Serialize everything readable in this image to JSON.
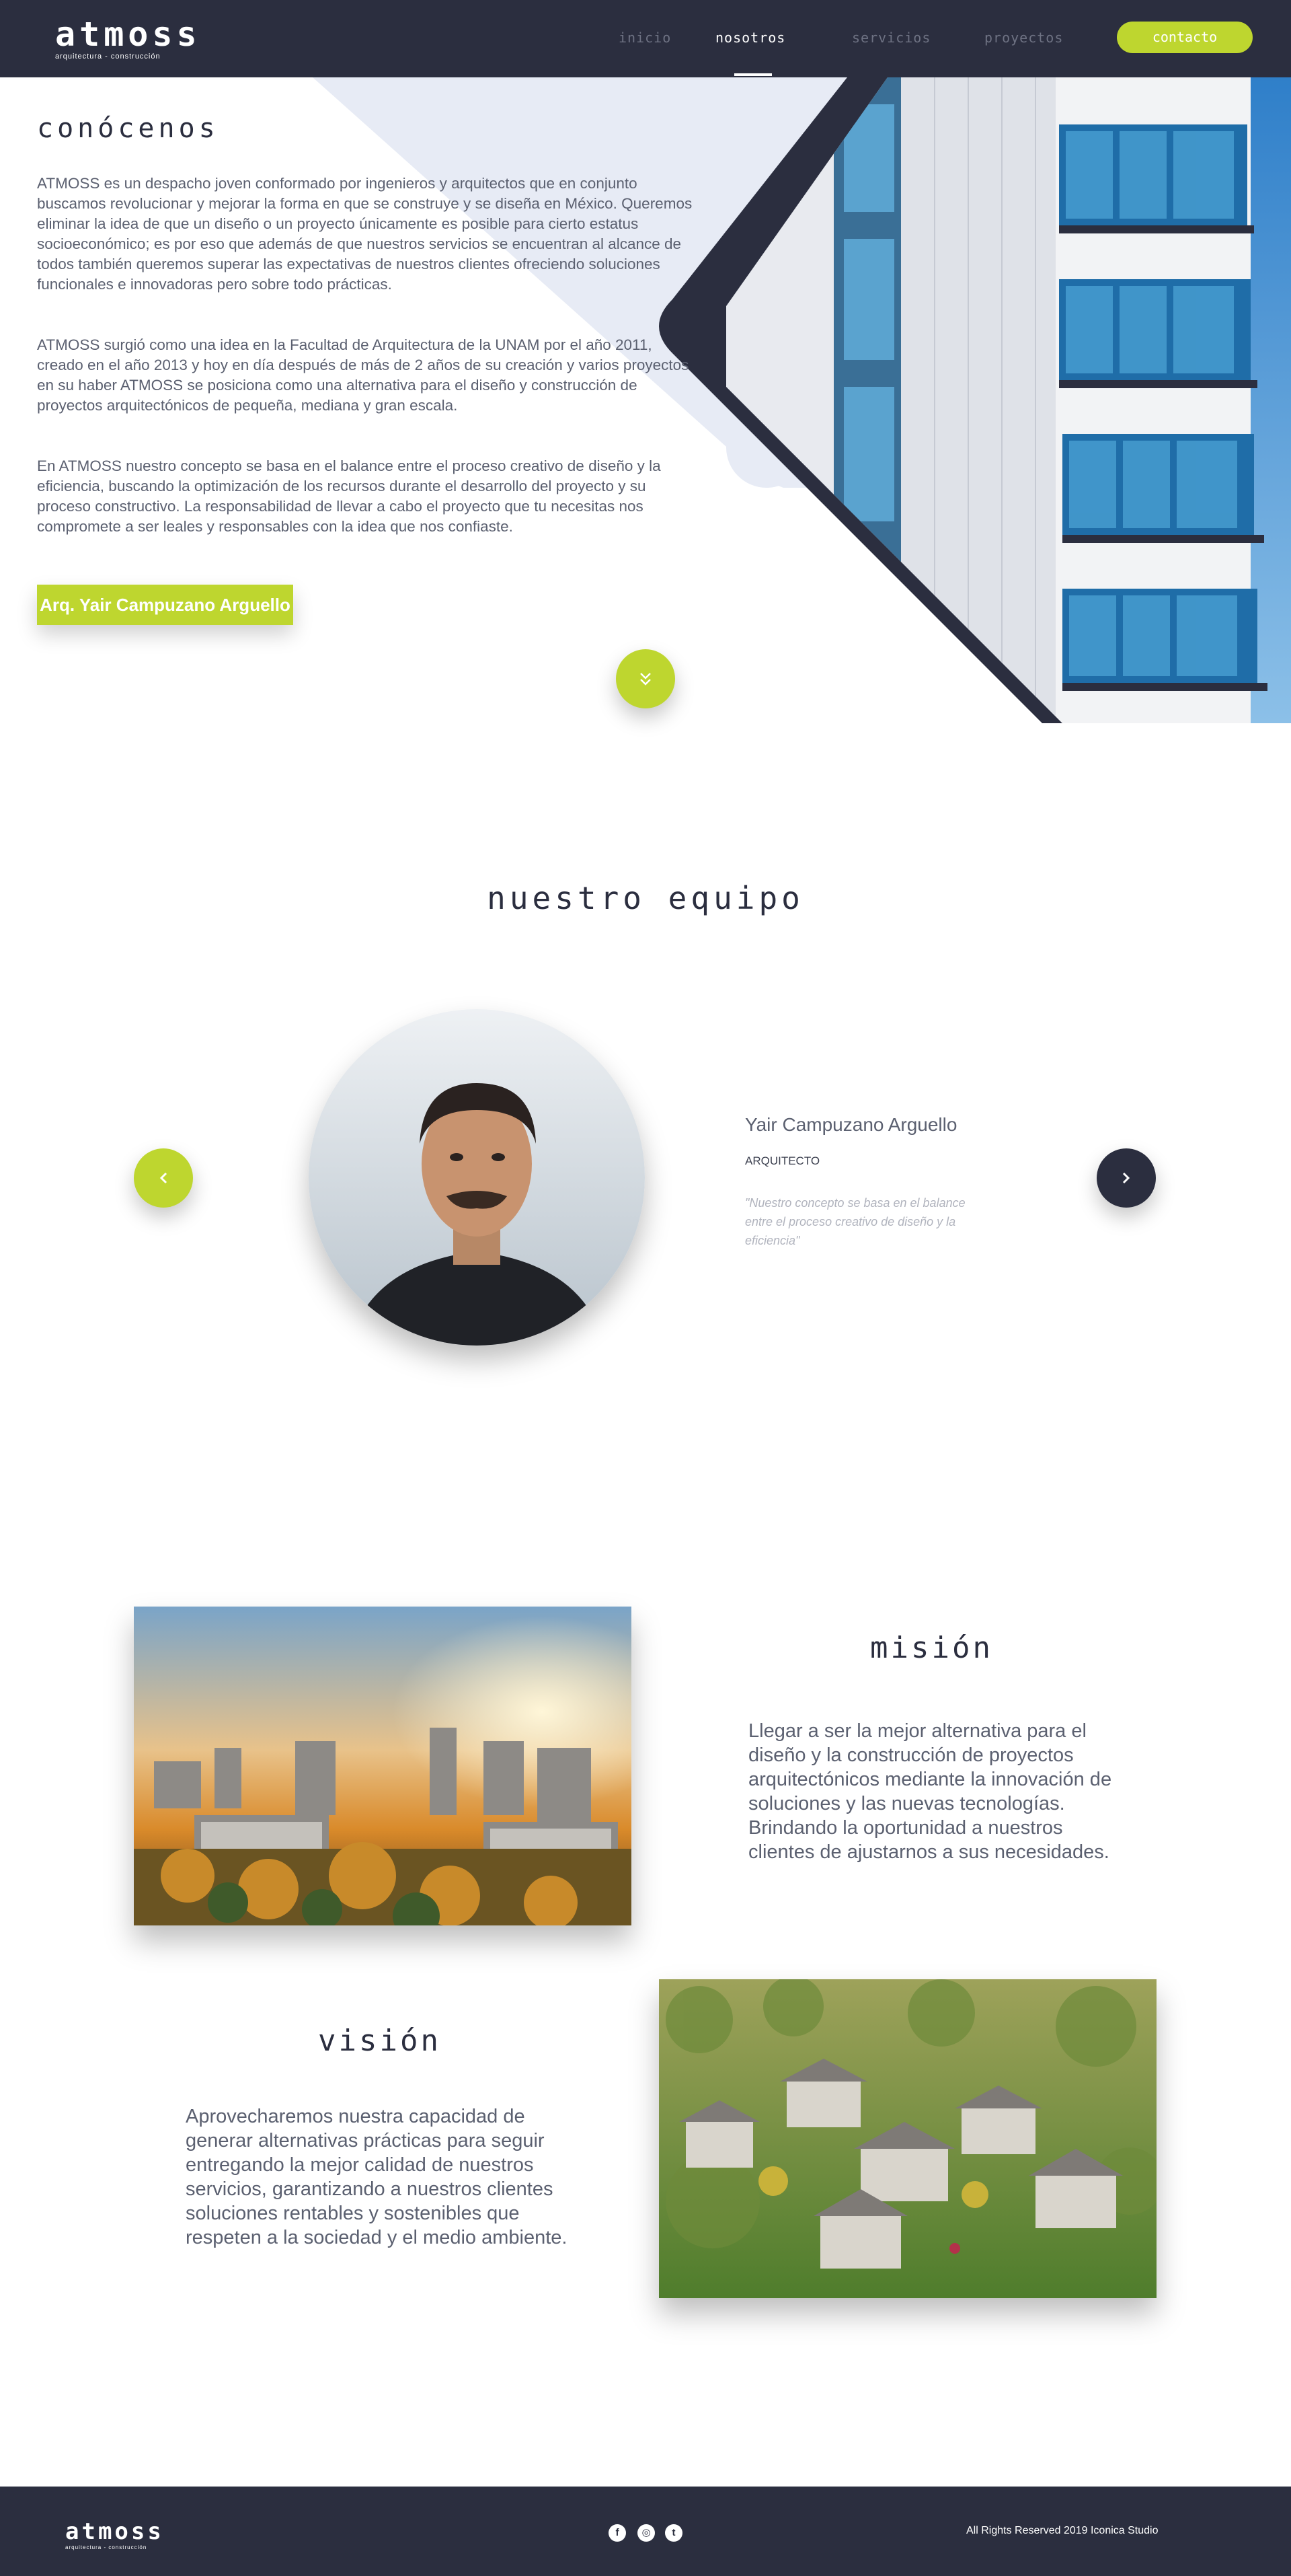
{
  "header": {
    "logo_text": "atmoss",
    "logo_tagline": "arquitectura - construcción",
    "nav": [
      {
        "label": "inicio"
      },
      {
        "label": "nosotros"
      },
      {
        "label": "servicios"
      },
      {
        "label": "proyectos"
      }
    ],
    "contact_label": "contacto",
    "active_nav": "nosotros"
  },
  "about": {
    "title": "conócenos",
    "paragraphs": [
      "ATMOSS es un despacho joven conformado por ingenieros y arquitectos que en conjunto buscamos revolucionar y mejorar la forma en que se construye y se diseña en México. Queremos eliminar la idea de que un diseño o un proyecto únicamente es posible para cierto estatus socioeconómico; es por eso que además de que nuestros servicios se encuentran al alcance de todos también queremos superar las expectativas de nuestros clientes ofreciendo soluciones funcionales e innovadoras pero sobre todo prácticas.",
      "ATMOSS surgió como una idea en la Facultad de Arquitectura de la UNAM por el año 2011, creado en el año 2013 y hoy en día después de más de 2 años de su creación y varios proyectos en su haber ATMOSS se posiciona como una alternativa para el diseño y construcción de proyectos arquitectónicos de pequeña, mediana y gran escala.",
      "En ATMOSS nuestro concepto se basa en el balance entre el proceso creativo de diseño y la eficiencia, buscando la optimización de los recursos durante el desarrollo del proyecto y su proceso constructivo. La responsabilidad de llevar a cabo el proyecto que tu necesitas nos compromete a ser leales y responsables con la idea que nos confiaste."
    ],
    "button_label": "Arq. Yair Campuzano Arguello"
  },
  "team": {
    "title": "nuestro equipo",
    "member": {
      "name": "Yair Campuzano Arguello",
      "role": "ARQUITECTO",
      "quote": "\"Nuestro concepto se basa en el balance entre el proceso creativo de diseño y la eficiencia\""
    },
    "prev_icon": "chevron-left-icon",
    "next_icon": "chevron-right-icon"
  },
  "mission": {
    "title": "misión",
    "text": "Llegar a ser la mejor alternativa para el diseño y la construcción de proyectos arquitectónicos mediante la innovación de soluciones y las nuevas tecnologías. Brindando la oportunidad a nuestros clientes de ajustarnos a sus necesidades."
  },
  "vision": {
    "title": "visión",
    "text": "Aprovecharemos nuestra capacidad de generar alternativas prácticas para seguir entregando la mejor calidad de nuestros servicios, garantizando a nuestros clientes soluciones rentables y sostenibles que respeten a la sociedad y el medio ambiente."
  },
  "footer": {
    "logo_text": "atmoss",
    "logo_tagline": "arquitectura - construcción",
    "social": [
      {
        "icon": "facebook-icon",
        "glyph": "f"
      },
      {
        "icon": "instagram-icon",
        "glyph": "◎"
      },
      {
        "icon": "twitter-icon",
        "glyph": "t"
      }
    ],
    "copyright": "All Rights Reserved 2019 Iconica Studio"
  },
  "colors": {
    "dark": "#2b2e3f",
    "accent": "#bed62f",
    "light_blue_bg": "#e7ebf5"
  }
}
